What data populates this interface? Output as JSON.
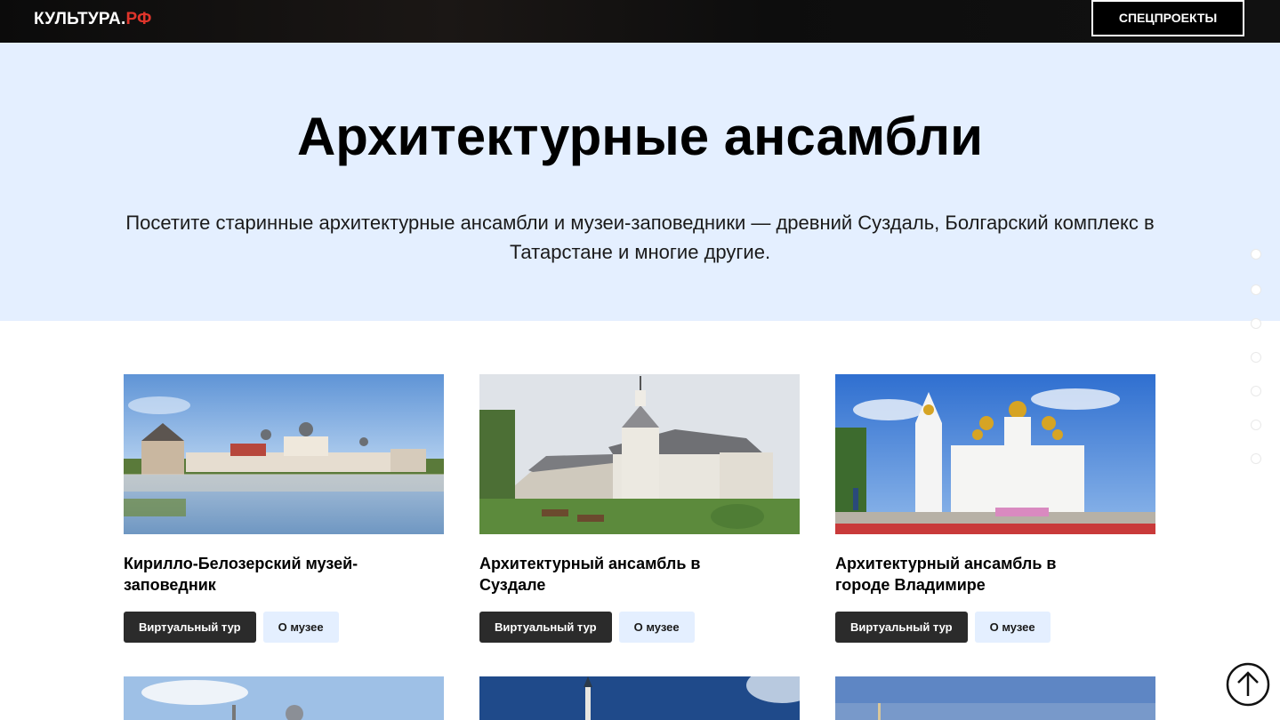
{
  "header": {
    "logo_main": "КУЛЬТУРА.",
    "logo_accent": "РФ",
    "special_button": "СПЕЦПРОЕКТЫ"
  },
  "hero": {
    "title": "Архитектурные ансамбли",
    "description": "Посетите старинные архитектурные ансамбли и музеи-заповедники — древний Суздаль, Болгарский комплекс в Татарстане и многие другие."
  },
  "cards": [
    {
      "title": "Кирилло-Белозерский музей-заповедник",
      "tour_label": "Виртуальный тур",
      "about_label": "О музее"
    },
    {
      "title": "Архитектурный ансамбль в Суздале",
      "tour_label": "Виртуальный тур",
      "about_label": "О музее"
    },
    {
      "title": "Архитектурный ансамбль в городе Владимире",
      "tour_label": "Виртуальный тур",
      "about_label": "О музее"
    }
  ],
  "icons": {
    "scroll_top": "arrow-up-circle-icon"
  },
  "colors": {
    "hero_background": "#e4efff",
    "logo_accent": "#e0352b",
    "dark_button": "#2b2b2b"
  }
}
